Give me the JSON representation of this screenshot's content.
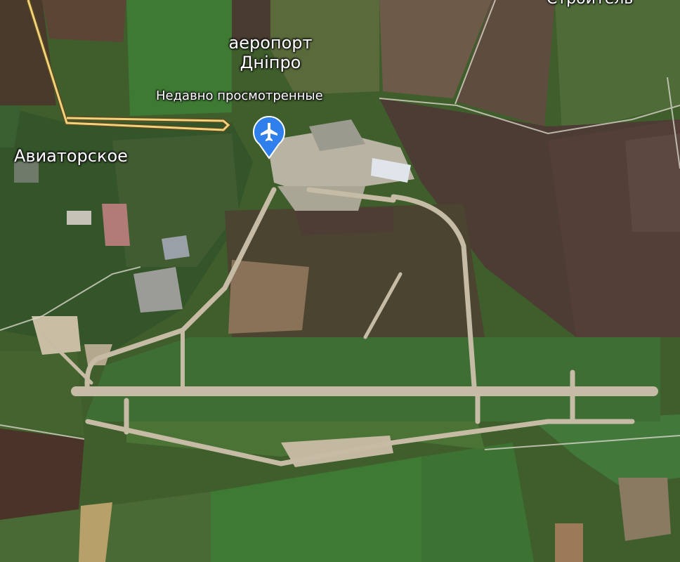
{
  "map": {
    "airport_poi": {
      "name_line1": "аеропорт",
      "name_line2": "Дніпро",
      "subtitle": "Недавно просмотренные",
      "icon": "airplane-pin-icon",
      "pin_color": "#2f80ed"
    },
    "place_labels": {
      "village": "Авиаторское",
      "town_cut_off": "Строитель"
    },
    "route": {
      "color": "#f2d27a"
    }
  }
}
